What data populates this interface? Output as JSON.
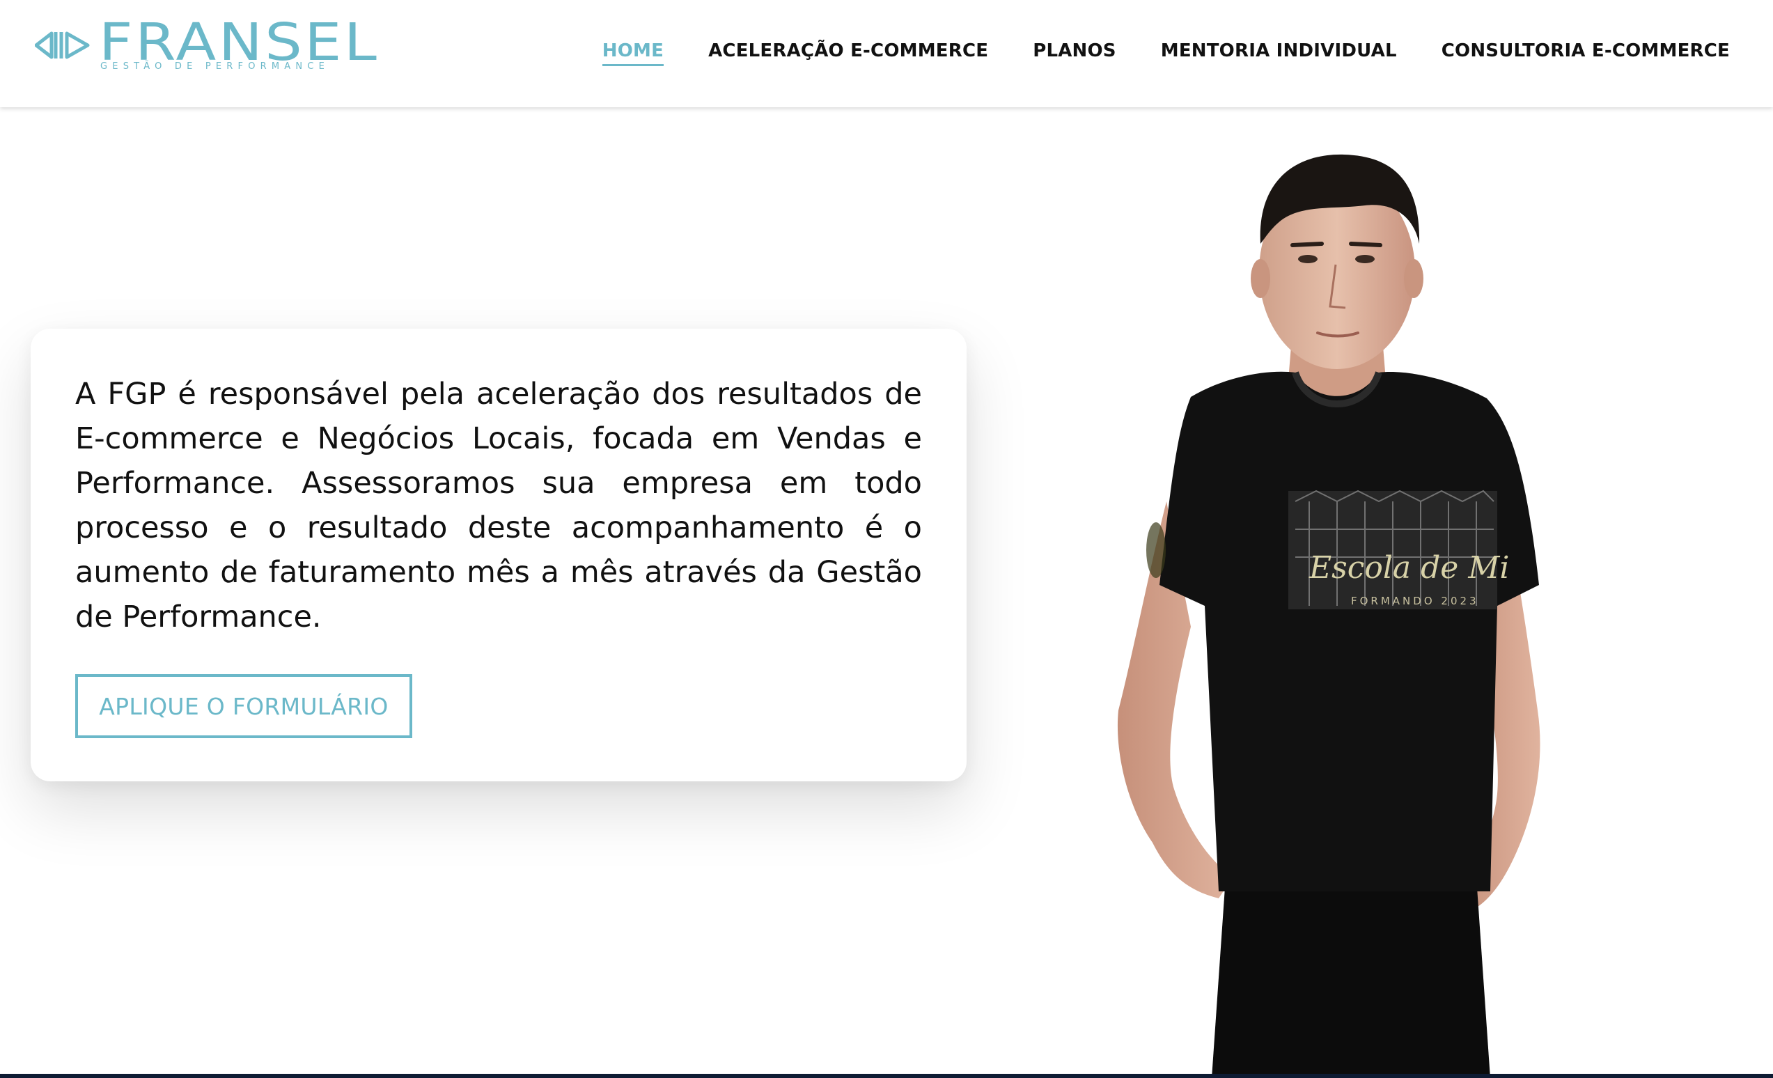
{
  "brand": {
    "name": "FRANSEL",
    "tagline": "GESTÃO DE PERFORMANCE",
    "color": "#6bb8c9"
  },
  "nav": {
    "items": [
      {
        "label": "HOME",
        "active": true
      },
      {
        "label": "ACELERAÇÃO E-COMMERCE",
        "active": false
      },
      {
        "label": "PLANOS",
        "active": false
      },
      {
        "label": "MENTORIA INDIVIDUAL",
        "active": false
      },
      {
        "label": "CONSULTORIA E-COMMERCE",
        "active": false
      }
    ]
  },
  "hero": {
    "text": "A FGP é responsável pela aceleração dos resultados de E-commerce e Negócios Locais, focada em Vendas e Performance. Assessoramos sua empresa em todo processo e o resultado deste acompanhamento é o aumento de faturamento mês a mês através da Gestão de Performance.",
    "cta_label": "APLIQUE O FORMULÁRIO"
  },
  "photo": {
    "shirt_print": "Escola de Mi",
    "shirt_print_sub": "FORMANDO 2023"
  },
  "colors": {
    "accent": "#6bb8c9",
    "text": "#111111",
    "background": "#ffffff"
  }
}
